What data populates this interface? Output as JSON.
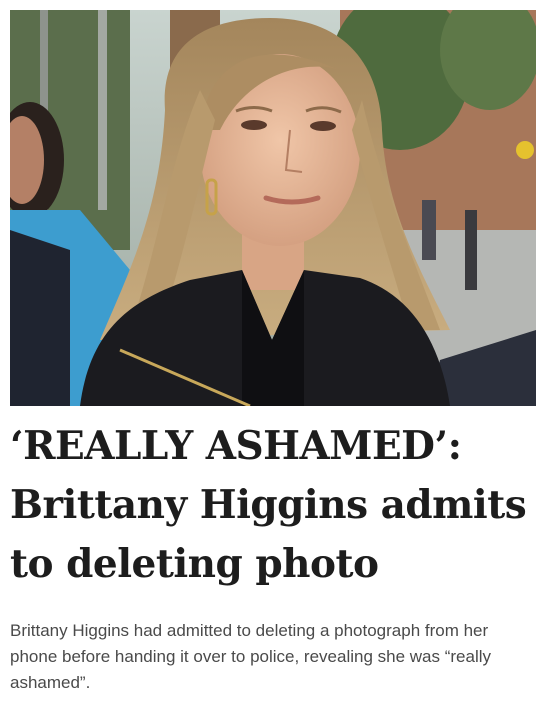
{
  "article": {
    "headline": "‘REALLY ASHAMED’: Brittany Higgins admits to deleting photo",
    "summary": "Brittany Higgins had admitted to deleting a photograph from her phone before handing it over to police, revealing she was “really ashamed”."
  },
  "colors": {
    "headline_text": "#1d1d1d",
    "summary_text": "#4a4a4a",
    "background": "#ffffff"
  }
}
